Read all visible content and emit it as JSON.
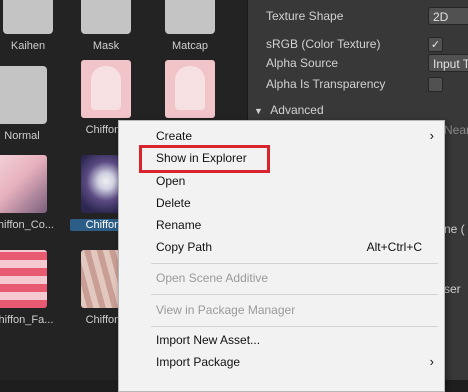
{
  "assets": {
    "row1": [
      "Kaihen",
      "Mask",
      "Matcap"
    ],
    "row2": [
      "Normal",
      "Chiffon_"
    ],
    "row3": [
      "Chiffon_Co...",
      "Chiffon_"
    ],
    "row4": [
      "Chiffon_Fa...",
      "Chiffon_"
    ]
  },
  "inspector": {
    "texture_shape_label": "Texture Shape",
    "texture_shape_value": "2D",
    "srgb_label": "sRGB (Color Texture)",
    "srgb_checked": "✓",
    "alpha_source_label": "Alpha Source",
    "alpha_source_value": "Input T",
    "alpha_transparency_label": "Alpha Is Transparency",
    "advanced_label": "Advanced",
    "partial_right_1": "Near",
    "partial_right_2": "ne (",
    "partial_right_3": "ser"
  },
  "context_menu": {
    "items": [
      {
        "label": "Create",
        "submenu": true
      },
      {
        "label": "Show in Explorer"
      },
      {
        "label": "Open"
      },
      {
        "label": "Delete"
      },
      {
        "label": "Rename"
      },
      {
        "label": "Copy Path",
        "shortcut": "Alt+Ctrl+C"
      },
      {
        "label": "Open Scene Additive",
        "disabled": true
      },
      {
        "label": "View in Package Manager",
        "disabled": true
      },
      {
        "label": "Import New Asset..."
      },
      {
        "label": "Import Package",
        "submenu": true
      }
    ],
    "highlighted": "Show in Explorer"
  },
  "colors": {
    "highlight_border": "#d9232d",
    "selection": "#2c5d87"
  }
}
